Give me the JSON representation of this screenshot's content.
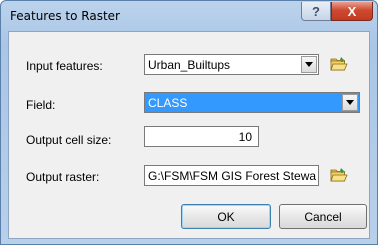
{
  "window": {
    "title": "Features to Raster"
  },
  "titlebar": {
    "help_label": "?",
    "close_label": "X"
  },
  "form": {
    "input_features": {
      "label": "Input features:",
      "value": "Urban_Builtups"
    },
    "field": {
      "label": "Field:",
      "value": "CLASS"
    },
    "output_cell_size": {
      "label": "Output cell size:",
      "value": "10"
    },
    "output_raster": {
      "label": "Output raster:",
      "value": "G:\\FSM\\FSM GIS Forest Stewa"
    }
  },
  "buttons": {
    "ok_label": "OK",
    "cancel_label": "Cancel"
  },
  "icons": {
    "browse": "open-folder-icon",
    "dropdown": "chevron-down-icon"
  },
  "colors": {
    "selection": "#3399ff",
    "close_button": "#c8452e",
    "title_gradient": "#a9c6e6"
  }
}
